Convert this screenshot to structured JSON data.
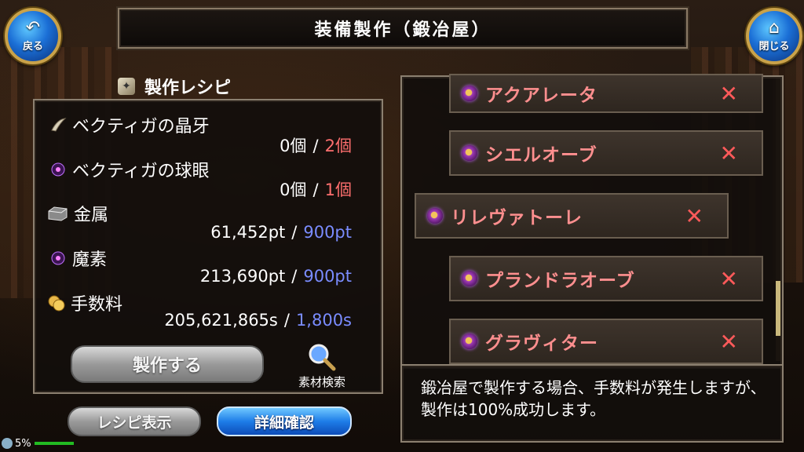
{
  "header": {
    "title": "装備製作（鍛冶屋）",
    "back_label": "戻る",
    "close_label": "閉じる"
  },
  "recipe_panel": {
    "title": "製作レシピ",
    "materials": [
      {
        "name": "ベクティガの晶牙",
        "icon": "fang-icon",
        "have": "0個",
        "need": "2個"
      },
      {
        "name": "ベクティガの球眼",
        "icon": "eye-orb-icon",
        "have": "0個",
        "need": "1個"
      },
      {
        "name": "金属",
        "icon": "metal-icon",
        "have": "61,452pt",
        "need": "900pt"
      },
      {
        "name": "魔素",
        "icon": "mana-icon",
        "have": "213,690pt",
        "need": "900pt"
      },
      {
        "name": "手数料",
        "icon": "coins-icon",
        "have": "205,621,865s",
        "need": "1,800s"
      }
    ],
    "separator": "/",
    "craft_label": "製作する",
    "search_label": "素材検索",
    "recipe_view_label": "レシピ表示",
    "detail_label": "詳細確認"
  },
  "recipe_list": [
    {
      "name": "アクアレータ"
    },
    {
      "name": "シエルオーブ"
    },
    {
      "name": "リレヴァトーレ"
    },
    {
      "name": "プランドラオーブ"
    },
    {
      "name": "グラヴィター"
    }
  ],
  "info": {
    "text": "鍛冶屋で製作する場合、手数料が発生しますが、製作は100%成功します。"
  },
  "status": {
    "percent": "5%"
  },
  "colors": {
    "need_insufficient": "#ff6f6f",
    "need_sufficient": "#7a8cff",
    "recipe_name": "#ff8f8f"
  }
}
